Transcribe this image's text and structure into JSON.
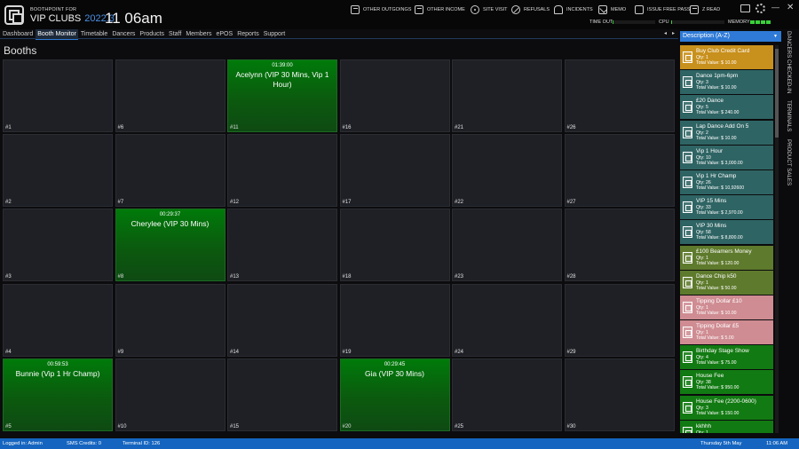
{
  "app": {
    "brand_small": "BOOTHPOINT FOR",
    "brand_name": "VIP CLUBS",
    "version": "2022.3",
    "clock": "11 06am"
  },
  "toolbar": {
    "buttons": [
      {
        "label": "OTHER OUTGOINGS",
        "icon": "receipt-icon"
      },
      {
        "label": "OTHER INCOME",
        "icon": "receipt-icon"
      },
      {
        "label": "SITE VISIT",
        "icon": "location-icon"
      },
      {
        "label": "REFUSALS",
        "icon": "no-entry-icon"
      },
      {
        "label": "INCIDENTS",
        "icon": "alarm-icon"
      },
      {
        "label": "MEMO",
        "icon": "envelope-icon"
      },
      {
        "label": "ISSUE FREE PASS",
        "icon": "ticket-icon"
      },
      {
        "label": "Z READ",
        "icon": "printer-icon"
      }
    ],
    "time_out_label": "TIME OUT",
    "cpu_label": "CPU",
    "memory_label": "MEMORY",
    "time_out_level": 0.02,
    "cpu_level": 0.02,
    "memory_segments": 4,
    "minimize": "—",
    "close": "✕"
  },
  "nav": {
    "items": [
      "Dashboard",
      "Booth Monitor",
      "Timetable",
      "Dancers",
      "Products",
      "Staff",
      "Members",
      "ePOS",
      "Reports",
      "Support"
    ],
    "active": "Booth Monitor",
    "prev": "◂",
    "next": "▸"
  },
  "booths": {
    "title": "Booths",
    "items": [
      {
        "num": "#1",
        "timer": "",
        "occupant": ""
      },
      {
        "num": "#2",
        "timer": "",
        "occupant": ""
      },
      {
        "num": "#3",
        "timer": "",
        "occupant": ""
      },
      {
        "num": "#4",
        "timer": "",
        "occupant": ""
      },
      {
        "num": "#5",
        "timer": "00:59:53",
        "occupant": "Bunnie (Vip 1 Hr Champ)"
      },
      {
        "num": "#6",
        "timer": "",
        "occupant": ""
      },
      {
        "num": "#7",
        "timer": "",
        "occupant": ""
      },
      {
        "num": "#8",
        "timer": "00:29:37",
        "occupant": "Cherylee (VIP 30 Mins)"
      },
      {
        "num": "#9",
        "timer": "",
        "occupant": ""
      },
      {
        "num": "#10",
        "timer": "",
        "occupant": ""
      },
      {
        "num": "#11",
        "timer": "01:39:00",
        "occupant": "Acelynn (VIP 30 Mins, Vip 1 Hour)"
      },
      {
        "num": "#12",
        "timer": "",
        "occupant": ""
      },
      {
        "num": "#13",
        "timer": "",
        "occupant": ""
      },
      {
        "num": "#14",
        "timer": "",
        "occupant": ""
      },
      {
        "num": "#15",
        "timer": "",
        "occupant": ""
      },
      {
        "num": "#16",
        "timer": "",
        "occupant": ""
      },
      {
        "num": "#17",
        "timer": "",
        "occupant": ""
      },
      {
        "num": "#18",
        "timer": "",
        "occupant": ""
      },
      {
        "num": "#19",
        "timer": "",
        "occupant": ""
      },
      {
        "num": "#20",
        "timer": "00:29:45",
        "occupant": "Gia (VIP 30 Mins)"
      },
      {
        "num": "#21",
        "timer": "",
        "occupant": ""
      },
      {
        "num": "#22",
        "timer": "",
        "occupant": ""
      },
      {
        "num": "#23",
        "timer": "",
        "occupant": ""
      },
      {
        "num": "#24",
        "timer": "",
        "occupant": ""
      },
      {
        "num": "#25",
        "timer": "",
        "occupant": ""
      },
      {
        "num": "#26",
        "timer": "",
        "occupant": ""
      },
      {
        "num": "#27",
        "timer": "",
        "occupant": ""
      },
      {
        "num": "#28",
        "timer": "",
        "occupant": ""
      },
      {
        "num": "#29",
        "timer": "",
        "occupant": ""
      },
      {
        "num": "#30",
        "timer": "",
        "occupant": ""
      }
    ]
  },
  "panel": {
    "sort_label": "Description (A-Z)",
    "products": [
      {
        "name": "Buy Club Credit Card",
        "qty": "Qty: 1",
        "value": "Total Value: $ 10.00",
        "color": "#c8901c"
      },
      {
        "name": "Dance 1pm-6pm",
        "qty": "Qty: 3",
        "value": "Total Value: $ 10.00",
        "color": "#2f6464"
      },
      {
        "name": "£20 Dance",
        "qty": "Qty: 5",
        "value": "Total Value: $ 240.00",
        "color": "#2f6464"
      },
      {
        "name": "Lap Dance Add On 5",
        "qty": "Qty: 2",
        "value": "Total Value: $ 10.00",
        "color": "#2f6464"
      },
      {
        "name": "Vip 1 Hour",
        "qty": "Qty: 10",
        "value": "Total Value: $ 3,000.00",
        "color": "#2f6464"
      },
      {
        "name": "Vip 1 Hr Champ",
        "qty": "Qty: 26",
        "value": "Total Value: $ 10,92600",
        "color": "#2f6464"
      },
      {
        "name": "VIP 15 Mins",
        "qty": "Qty: 33",
        "value": "Total Value: $ 2,970.00",
        "color": "#2f6464"
      },
      {
        "name": "VIP 30 Mins",
        "qty": "Qty: 58",
        "value": "Total Value: $ 8,800.00",
        "color": "#2f6464"
      },
      {
        "name": "£100 Beamers Money",
        "qty": "Qty: 1",
        "value": "Total Value: $ 120.00",
        "color": "#5e7a2c"
      },
      {
        "name": "Dance Chip k50",
        "qty": "Qty: 1",
        "value": "Total Value: $ 50.00",
        "color": "#5e7a2c"
      },
      {
        "name": "Tipping Dollar £10",
        "qty": "Qty: 1",
        "value": "Total Value: $ 10.00",
        "color": "#cf8c92"
      },
      {
        "name": "Tipping Dollar £5",
        "qty": "Qty: 1",
        "value": "Total Value: $ 5.00",
        "color": "#cf8c92"
      },
      {
        "name": "Birthday Stage Show",
        "qty": "Qty: 4",
        "value": "Total Value: $ 75.00",
        "color": "#127a12"
      },
      {
        "name": "House Fee",
        "qty": "Qty: 38",
        "value": "Total Value: $ 950.00",
        "color": "#127a12"
      },
      {
        "name": "House Fee (2200-0600)",
        "qty": "Qty: 3",
        "value": "Total Value: $ 150.00",
        "color": "#127a12"
      },
      {
        "name": "kkhhh",
        "qty": "Qty: 1",
        "value": "",
        "color": "#127a12"
      }
    ]
  },
  "side_tabs": [
    "DANCERS CHECKED-IN",
    "TERMINALS",
    "PRODUCT SALES"
  ],
  "status": {
    "logged_in": "Logged in: Admin",
    "sms": "SMS Credits: 0",
    "terminal": "Terminal ID: 126",
    "date": "Thursday 5th May",
    "time": "11:06 AM"
  },
  "colors": {
    "accent": "#2f7ad6",
    "active_booth": "#0b5a0e",
    "status_bar": "#1565c0"
  }
}
